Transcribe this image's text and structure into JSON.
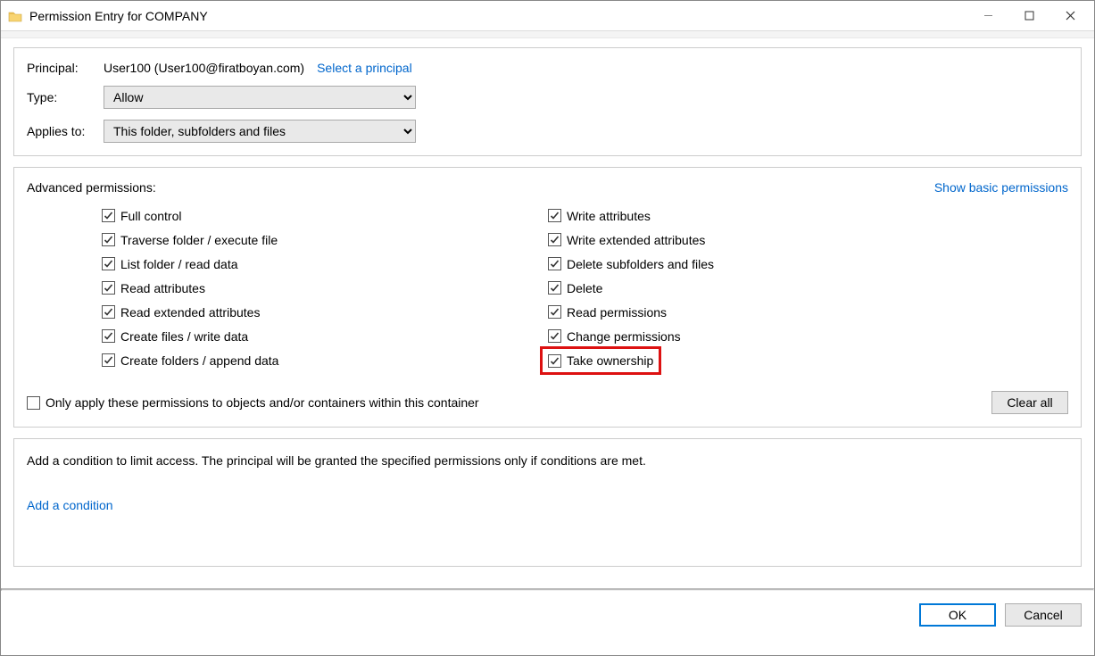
{
  "window": {
    "title": "Permission Entry for COMPANY"
  },
  "top": {
    "principal_label": "Principal:",
    "principal_value": "User100 (User100@firatboyan.com)",
    "select_principal": "Select a principal",
    "type_label": "Type:",
    "type_value": "Allow",
    "applies_label": "Applies to:",
    "applies_value": "This folder, subfolders and files"
  },
  "adv": {
    "heading": "Advanced permissions:",
    "show_basic": "Show basic permissions",
    "left": [
      "Full control",
      "Traverse folder / execute file",
      "List folder / read data",
      "Read attributes",
      "Read extended attributes",
      "Create files / write data",
      "Create folders / append data"
    ],
    "right": [
      "Write attributes",
      "Write extended attributes",
      "Delete subfolders and files",
      "Delete",
      "Read permissions",
      "Change permissions",
      "Take ownership"
    ],
    "only_apply": "Only apply these permissions to objects and/or containers within this container",
    "clear_all": "Clear all"
  },
  "cond": {
    "desc": "Add a condition to limit access. The principal will be granted the specified permissions only if conditions are met.",
    "add": "Add a condition"
  },
  "footer": {
    "ok": "OK",
    "cancel": "Cancel"
  }
}
